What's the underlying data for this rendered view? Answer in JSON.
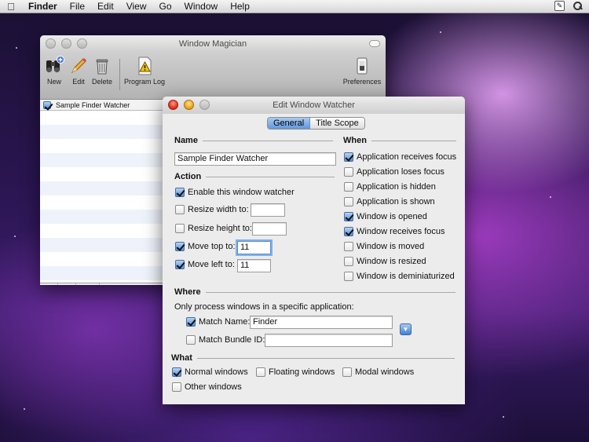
{
  "menubar": {
    "items": [
      "Finder",
      "File",
      "Edit",
      "View",
      "Go",
      "Window",
      "Help"
    ]
  },
  "main_window": {
    "title": "Window Magician",
    "toolbar": {
      "new": "New",
      "edit": "Edit",
      "delete": "Delete",
      "program_log": "Program Log",
      "preferences": "Preferences"
    },
    "list": {
      "rows": [
        {
          "label": "Sample Finder Watcher",
          "checked": true
        }
      ]
    },
    "bottom": {
      "add": "+",
      "remove": "−",
      "action": "⚙"
    }
  },
  "edit_window": {
    "title": "Edit Window Watcher",
    "tabs": {
      "general": "General",
      "title_scope": "Title Scope",
      "selected": "General"
    },
    "name_section": {
      "label": "Name",
      "value": "Sample Finder Watcher"
    },
    "action_section": {
      "label": "Action",
      "enable": {
        "label": "Enable this window watcher",
        "checked": true
      },
      "resize_width": {
        "label": "Resize width to:",
        "checked": false,
        "value": ""
      },
      "resize_height": {
        "label": "Resize height to:",
        "checked": false,
        "value": ""
      },
      "move_top": {
        "label": "Move top to:",
        "checked": true,
        "value": "11"
      },
      "move_left": {
        "label": "Move left to:",
        "checked": true,
        "value": "11"
      }
    },
    "when_section": {
      "label": "When",
      "items": [
        {
          "label": "Application receives focus",
          "checked": true
        },
        {
          "label": "Application loses focus",
          "checked": false
        },
        {
          "label": "Application is hidden",
          "checked": false
        },
        {
          "label": "Application is shown",
          "checked": false
        },
        {
          "label": "Window is opened",
          "checked": true
        },
        {
          "label": "Window receives focus",
          "checked": true
        },
        {
          "label": "Window is moved",
          "checked": false
        },
        {
          "label": "Window is resized",
          "checked": false
        },
        {
          "label": "Window is deminiaturized",
          "checked": false
        }
      ]
    },
    "where_section": {
      "label": "Where",
      "description": "Only process windows in a specific application:",
      "match_name": {
        "label": "Match Name:",
        "checked": true,
        "value": "Finder"
      },
      "match_bundle": {
        "label": "Match Bundle ID:",
        "checked": false,
        "value": ""
      }
    },
    "what_section": {
      "label": "What",
      "normal": {
        "label": "Normal windows",
        "checked": true
      },
      "floating": {
        "label": "Floating windows",
        "checked": false
      },
      "modal": {
        "label": "Modal windows",
        "checked": false
      },
      "other": {
        "label": "Other windows",
        "checked": false
      }
    }
  }
}
